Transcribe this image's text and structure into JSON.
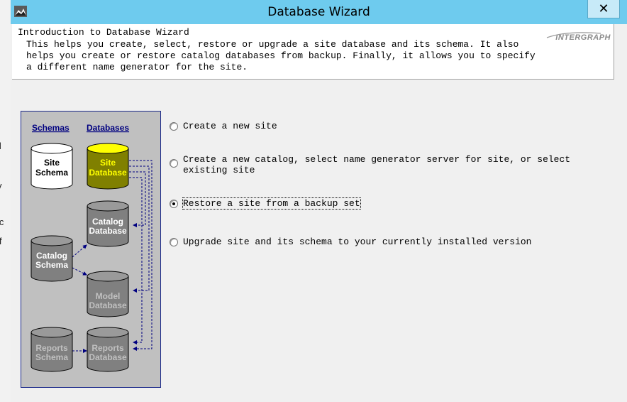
{
  "window": {
    "title": "Database Wizard",
    "close_glyph": "✕"
  },
  "background_fragments": [
    "t",
    "ll",
    "v",
    "ic",
    "if"
  ],
  "intro": {
    "title": "Introduction to Database Wizard",
    "description": "This helps you create, select, restore or upgrade a site database and its schema. It also\nhelps you create or restore catalog databases from backup. Finally, it allows you to specify\na different name generator for the site.",
    "logo": "INTERGRAPH"
  },
  "diagram": {
    "header_schemas": "Schemas",
    "header_databases": "Databases",
    "site_schema": [
      "Site",
      "Schema"
    ],
    "site_database": [
      "Site",
      "Database"
    ],
    "catalog_database": [
      "Catalog",
      "Database"
    ],
    "catalog_schema": [
      "Catalog",
      "Schema"
    ],
    "model_database": [
      "Model",
      "Database"
    ],
    "reports_schema": [
      "Reports",
      "Schema"
    ],
    "reports_database": [
      "Reports",
      "Database"
    ],
    "colors": {
      "panel": "#c0c0c0",
      "border": "#1c2a8a",
      "site_db_fill": "#808000",
      "site_db_text": "#ffff00",
      "white_cyl": "#ffffff",
      "gray_cyl": "#808080",
      "link": "#000080"
    }
  },
  "options": [
    {
      "label": "Create a new site",
      "selected": false
    },
    {
      "label": "Create a new catalog, select name generator server for site, or select\nexisting site",
      "selected": false
    },
    {
      "label": "Restore a site from a backup set",
      "selected": true
    },
    {
      "label": "Upgrade site and its schema to your currently installed version",
      "selected": false
    }
  ]
}
